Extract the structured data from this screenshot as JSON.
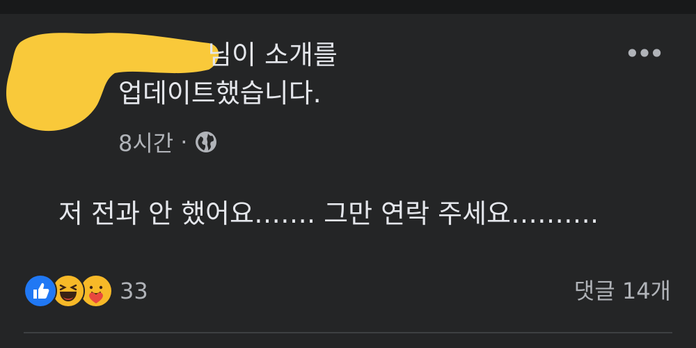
{
  "post": {
    "header_line_1": "님이 소개를",
    "header_line_2": "업데이트했습니다.",
    "time": "8시간",
    "dot": "·",
    "privacy_icon": "globe-icon",
    "more_icon": "more-horizontal-icon",
    "body": "저 전과 안 했어요……. 그만 연락 주세요………."
  },
  "reactions": {
    "icons": [
      "like-icon",
      "haha-icon",
      "care-icon"
    ],
    "count": "33"
  },
  "comments": {
    "label": "댓글 14개"
  },
  "colors": {
    "background": "#242526",
    "text_primary": "#e4e6eb",
    "text_secondary": "#b0b3b8",
    "like_blue": "#2078f4",
    "emoji_yellow": "#f7b928",
    "redaction_yellow": "#f9c93a"
  }
}
